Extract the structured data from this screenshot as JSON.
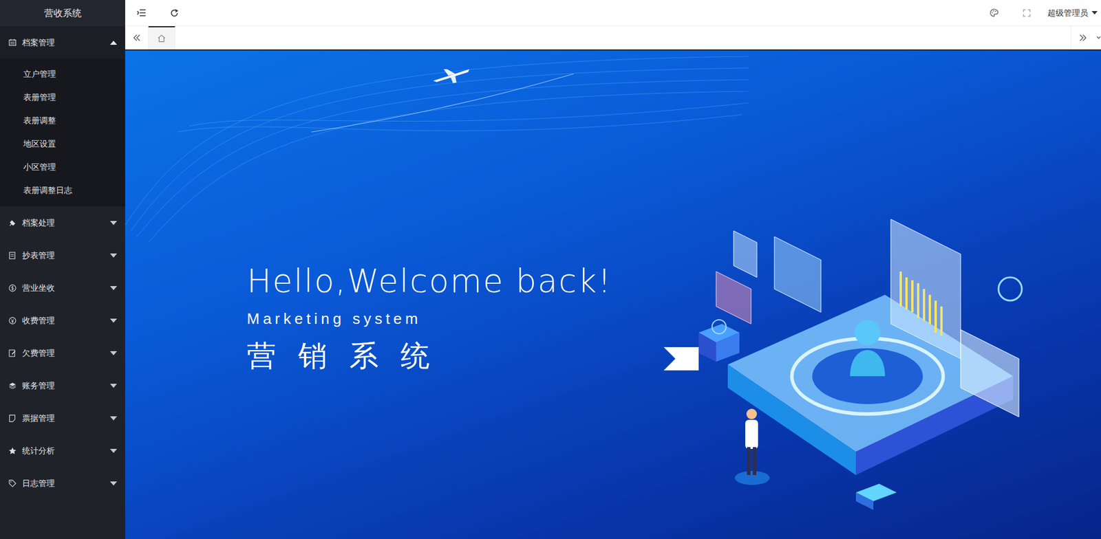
{
  "app": {
    "title": "营收系统"
  },
  "header": {
    "user": "超级管理员"
  },
  "sidebar": {
    "items": [
      {
        "label": "档案管理",
        "expanded": true,
        "children": [
          "立户管理",
          "表册管理",
          "表册调整",
          "地区设置",
          "小区管理",
          "表册调整日志"
        ]
      },
      {
        "label": "档案处理",
        "expanded": false,
        "children": []
      },
      {
        "label": "抄表管理",
        "expanded": false,
        "children": []
      },
      {
        "label": "营业坐收",
        "expanded": false,
        "children": []
      },
      {
        "label": "收费管理",
        "expanded": false,
        "children": []
      },
      {
        "label": "欠费管理",
        "expanded": false,
        "children": []
      },
      {
        "label": "账务管理",
        "expanded": false,
        "children": []
      },
      {
        "label": "票据管理",
        "expanded": false,
        "children": []
      },
      {
        "label": "统计分析",
        "expanded": false,
        "children": []
      },
      {
        "label": "日志管理",
        "expanded": false,
        "children": []
      }
    ]
  },
  "tabs": [
    {
      "kind": "home",
      "selected": true
    }
  ],
  "banner": {
    "greeting": "Hello,Welcome back!",
    "subtitle": "Marketing system",
    "title": "营销系统"
  }
}
